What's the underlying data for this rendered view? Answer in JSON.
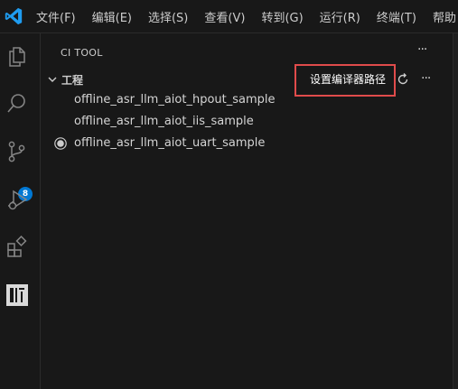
{
  "menubar": {
    "items": [
      "文件(F)",
      "编辑(E)",
      "选择(S)",
      "查看(V)",
      "转到(G)",
      "运行(R)",
      "终端(T)",
      "帮助"
    ]
  },
  "activity_bar": {
    "icons": [
      "files-icon",
      "search-icon",
      "source-control-icon",
      "run-debug-icon",
      "extensions-icon",
      "ci-tool-icon"
    ],
    "source_control_badge": "8",
    "accent": "#0078d4"
  },
  "sidebar": {
    "title": "CI TOOL",
    "section": {
      "title": "工程",
      "action_label": "设置编译器路径",
      "highlight_color": "#e04b4b"
    },
    "items": [
      {
        "label": "offline_asr_llm_aiot_hpout_sample",
        "icon": ""
      },
      {
        "label": "offline_asr_llm_aiot_iis_sample",
        "icon": ""
      },
      {
        "label": "offline_asr_llm_aiot_uart_sample",
        "icon": "radio-selected-icon"
      }
    ]
  }
}
